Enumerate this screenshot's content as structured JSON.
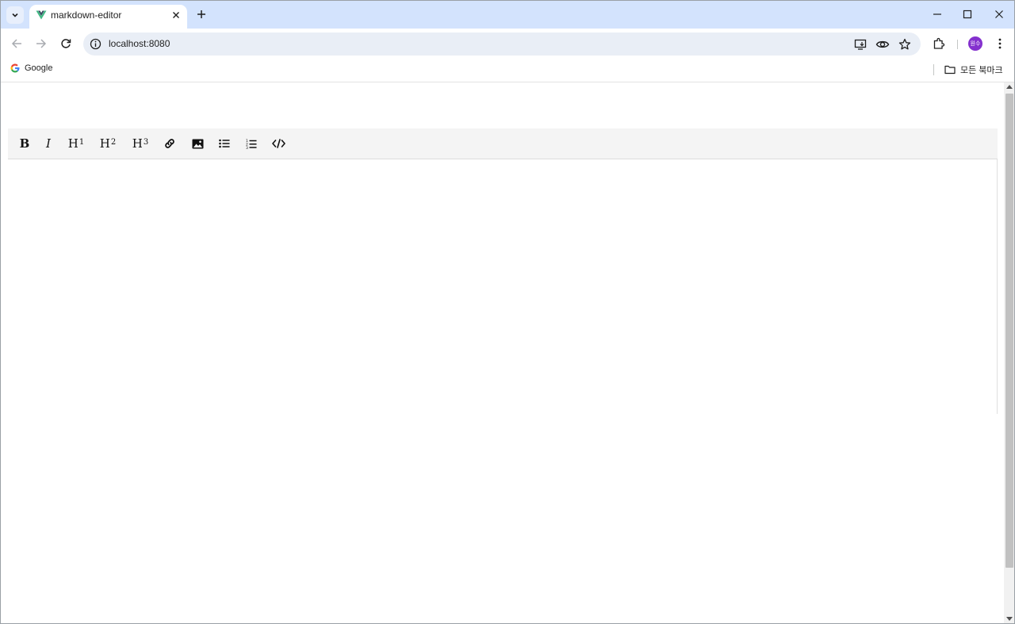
{
  "browser": {
    "tab": {
      "title": "markdown-editor"
    },
    "url": "localhost:8080",
    "avatar_text": "원수",
    "bookmarks": [
      {
        "label": "Google"
      }
    ],
    "all_bookmarks_label": "모든 북마크"
  },
  "editor": {
    "toolbar": {
      "bold": "B",
      "italic": "I",
      "h1": "H",
      "h1_sup": "1",
      "h2": "H",
      "h2_sup": "2",
      "h3": "H",
      "h3_sup": "3",
      "items": [
        "bold",
        "italic",
        "heading-1",
        "heading-2",
        "heading-3",
        "link",
        "image",
        "bullet-list",
        "ordered-list",
        "code"
      ]
    },
    "content": ""
  },
  "colors": {
    "tabstrip_bg": "#d3e3fd",
    "omnibox_bg": "#e9eef6",
    "avatar_bg": "#8430ce",
    "editor_toolbar_bg": "#f4f4f4",
    "vue_green": "#41b883",
    "vue_dark": "#35495e"
  }
}
